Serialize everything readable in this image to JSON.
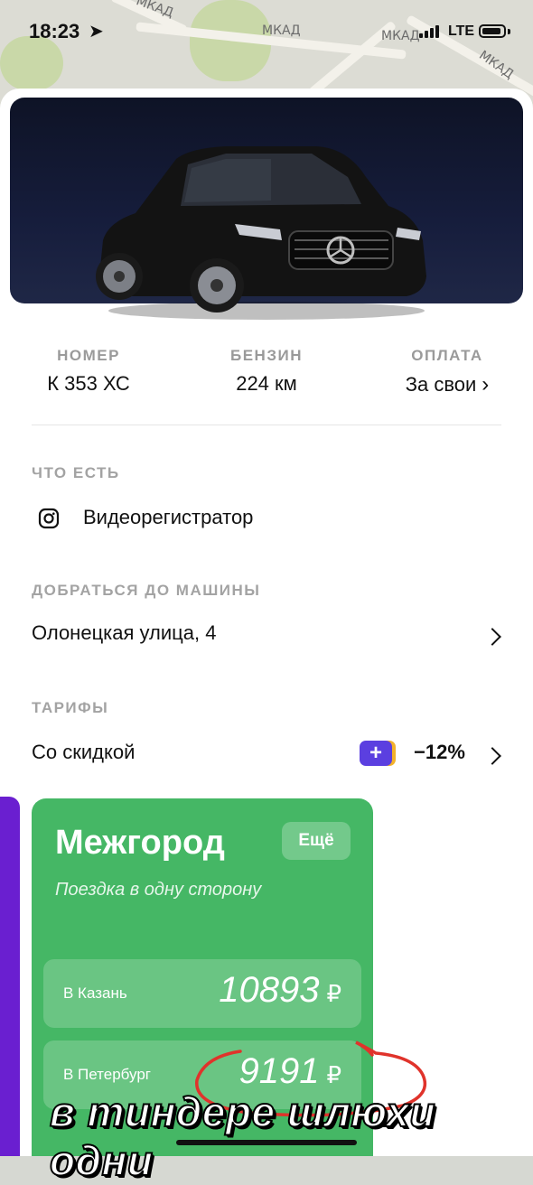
{
  "status_bar": {
    "time": "18:23",
    "network": "LTE"
  },
  "map": {
    "labels": [
      "МКАД",
      "МКАД",
      "МКАД",
      "МКАД"
    ]
  },
  "stats": [
    {
      "key": "НОМЕР",
      "value": "К 353 ХС"
    },
    {
      "key": "БЕНЗИН",
      "value": "224 км"
    },
    {
      "key": "ОПЛАТА",
      "value": "За свои"
    }
  ],
  "features": {
    "header": "ЧТО ЕСТЬ",
    "item": "Видеорегистратор"
  },
  "directions": {
    "header": "ДОБРАТЬСЯ ДО МАШИНЫ",
    "address": "Олонецкая улица, 4"
  },
  "tariffs": {
    "header": "ТАРИФЫ",
    "name": "Со скидкой",
    "plus_badge": "+",
    "discount": "−12%"
  },
  "intercity": {
    "title": "Межгород",
    "more_label": "Ещё",
    "subtitle": "Поездка в одну сторону",
    "destinations": [
      {
        "label": "В Казань",
        "price": "10893",
        "currency": "₽"
      },
      {
        "label": "В Петербург",
        "price": "9191",
        "currency": "₽"
      }
    ]
  },
  "overlay_caption": "в тиндере шлюхи одни",
  "colors": {
    "card_green": "#45b765",
    "purple_accent": "#6a1fd0",
    "plus_badge": "#5b3fe0",
    "annotation_red": "#e0332b"
  },
  "icons": {
    "location": "location-arrow-icon",
    "feature": "instagram-camera-icon",
    "chevron": "chevron-right-icon"
  }
}
